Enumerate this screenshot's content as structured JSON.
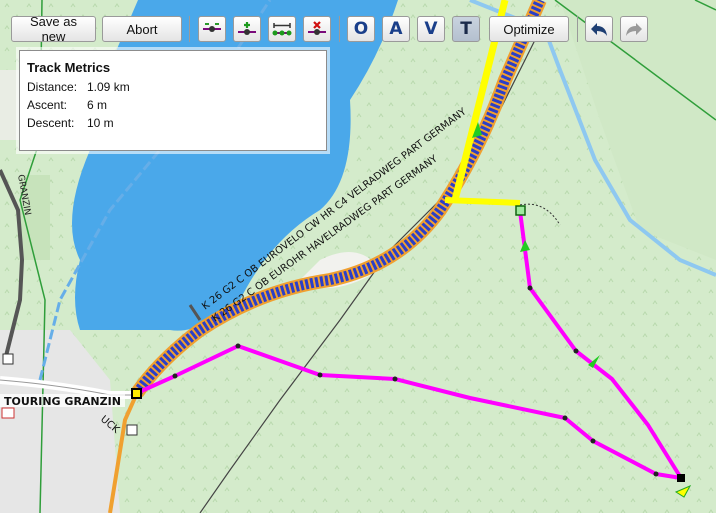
{
  "toolbar": {
    "save_label": "Save as new",
    "abort_label": "Abort",
    "mode_buttons": [
      "O",
      "A",
      "V",
      "T"
    ],
    "optimize_label": "Optimize",
    "icons": [
      "split-track-icon",
      "add-point-icon",
      "track-points-icon",
      "delete-point-icon",
      "undo-icon",
      "redo-icon"
    ]
  },
  "metrics": {
    "title": "Track Metrics",
    "rows": [
      {
        "label": "Distance:",
        "value": "1.09 km"
      },
      {
        "label": "Ascent:",
        "value": "6 m"
      },
      {
        "label": "Descent:",
        "value": "10 m"
      }
    ]
  },
  "map": {
    "road_label_1": "K 26  G2 C OB EUROVELO CW HR C4 VELRADWEG PART GERMANY",
    "road_label_2": "K 26 G2 C OB EUROHR HAVELRADWEG PART GERMANY",
    "place_label": "TOURING GRANZIN",
    "road_label_left": "GRANZIN",
    "side_label": "UCK",
    "track_color": "#ff00ff",
    "water_color": "#4aa8ea",
    "forest_color": "#d6eccd"
  }
}
